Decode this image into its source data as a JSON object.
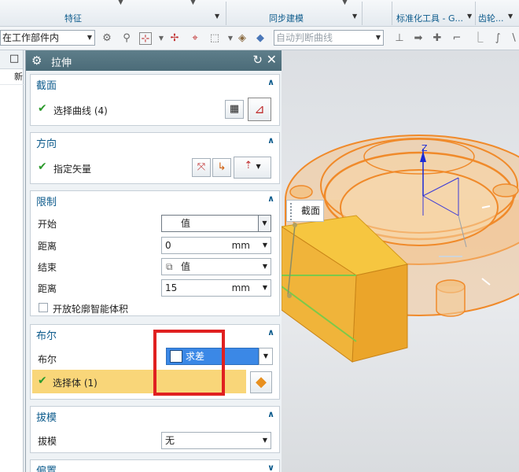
{
  "ribbon": {
    "groups": [
      {
        "label": "特征"
      },
      {
        "label": "同步建模"
      },
      {
        "label": "标准化工具 - G..."
      },
      {
        "label": "齿轮..."
      }
    ]
  },
  "toolbar": {
    "scope_filter": "在工作部件内",
    "curve_rule_placeholder": "自动判断曲线"
  },
  "navigator": {
    "header_label": "新"
  },
  "dialog": {
    "title": "拉伸",
    "section": {
      "label": "截面",
      "select_curve_label": "选择曲线 (4)"
    },
    "direction": {
      "label": "方向",
      "specify_vector_label": "指定矢量"
    },
    "limits": {
      "label": "限制",
      "start_label": "开始",
      "start_value": "值",
      "start_distance_label": "距离",
      "start_distance": "0",
      "start_unit": "mm",
      "end_label": "结束",
      "end_value": "值",
      "end_distance_label": "距离",
      "end_distance": "15",
      "end_unit": "mm",
      "open_profile_label": "开放轮廓智能体积"
    },
    "boolean": {
      "label": "布尔",
      "row_label": "布尔",
      "value": "求差",
      "select_body_label": "选择体 (1)"
    },
    "draft": {
      "label": "拔模",
      "row_label": "拔模",
      "value": "无"
    },
    "offset": {
      "label": "偏置"
    }
  },
  "viewport": {
    "section_tag": "截面",
    "axis_label": "Z"
  }
}
